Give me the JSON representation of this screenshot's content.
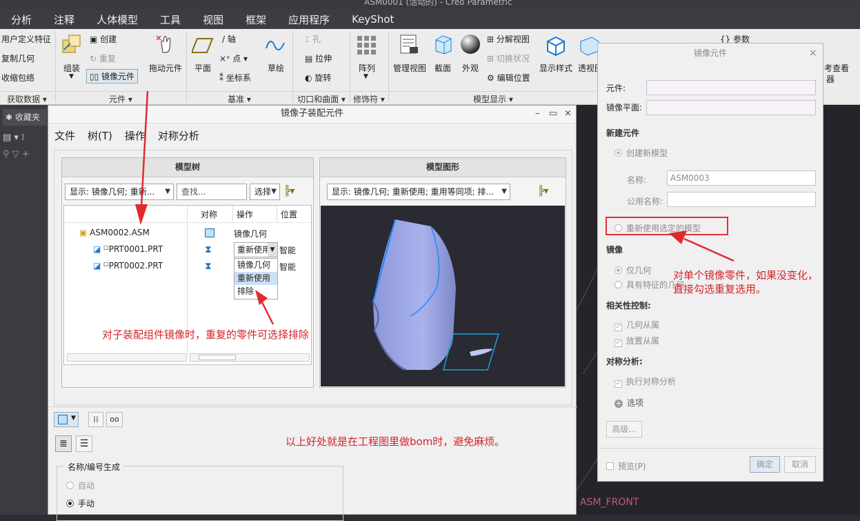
{
  "window_title": "ASM0001 (活动的) - Creo Parametric",
  "menu_tabs": [
    "分析",
    "注释",
    "人体模型",
    "工具",
    "视图",
    "框架",
    "应用程序",
    "KeyShot"
  ],
  "ribbon": {
    "get_data": {
      "items": [
        "用户定义特征",
        "复制几何",
        "收缩包络"
      ],
      "label": "获取数据"
    },
    "component": {
      "assemble": "组装",
      "create": "创建",
      "repeat": "重复",
      "mirror": "镜像元件",
      "drag": "拖动元件",
      "label": "元件"
    },
    "datum": {
      "plane": "平面",
      "axis": "轴",
      "point": "点",
      "csys": "坐标系",
      "sketch": "草绘",
      "label": "基准"
    },
    "cut_surface": {
      "hole": "孔",
      "extrude": "拉伸",
      "revolve": "旋转",
      "label": "切口和曲面"
    },
    "modifiers": {
      "pattern": "阵列",
      "label": "修饰符"
    },
    "model_display": {
      "manage_views": "管理视图",
      "section": "截面",
      "appearance": "外观",
      "explode_view": "分解视图",
      "toggle_status": "切换状况",
      "edit_position": "编辑位置",
      "display_style": "显示样式",
      "perspective": "透视图",
      "label": "模型显示"
    },
    "partial_right": {
      "params": "参数",
      "ref_viewer_1": "考查看",
      "ref_viewer_2": "器"
    }
  },
  "left_strip": {
    "favorites": "收藏夹"
  },
  "mirror_subasm_dialog": {
    "title": "镜像子装配元件",
    "menu": [
      "文件",
      "树(T)",
      "操作",
      "对称分析"
    ],
    "model_tree": {
      "header": "模型树",
      "display_combo": "显示: 镜像几何; 重新...",
      "find_placeholder": "查找...",
      "select_combo": "选择",
      "columns": {
        "symmetry": "对称",
        "operation": "操作",
        "position": "位置"
      },
      "rows": [
        {
          "name": "ASM0002.ASM",
          "operation": "镜像几何",
          "position": ""
        },
        {
          "name": "PRT0001.PRT",
          "operation": "重新使用",
          "position": "智能"
        },
        {
          "name": "PRT0002.PRT",
          "operation": "",
          "position": "智能"
        }
      ],
      "dropdown_options": [
        "镜像几何",
        "重新使用",
        "排除"
      ]
    },
    "model_graphic": {
      "header": "模型图形",
      "display_combo": "显示: 镜像几何; 重新使用; 重用等同项; 排..."
    },
    "name_generation": {
      "label": "名称/编号生成",
      "auto": "自动",
      "manual": "手动"
    }
  },
  "mirror_component_dialog": {
    "title": "镜像元件",
    "component_label": "元件:",
    "mirror_plane_label": "镜像平面:",
    "new_component_heading": "新建元件",
    "create_new_model": "创建新模型",
    "name_label": "名称:",
    "name_value": "ASM0003",
    "common_name_label": "公用名称:",
    "reuse_selected": "重新使用选定的模型",
    "mirror_heading": "镜像",
    "geometry_only": "仅几何",
    "with_features": "具有特征的几何",
    "dependency_heading": "相关性控制:",
    "geometry_dependent": "几何从属",
    "placement_dependent": "放置从属",
    "symmetry_heading": "对称分析:",
    "perform_symmetry": "执行对称分析",
    "options": "选项",
    "advanced": "高级...",
    "preview": "预览(P)",
    "ok": "确定",
    "cancel": "取消"
  },
  "annotations": {
    "a1": "对子装配组件镜像时，重复的零件可选择排除",
    "a2_line1": "对单个镜像零件，如果没变化，",
    "a2_line2": "直接勾选重复选用。",
    "a3": "以上好处就是在工程图里做bom时，避免麻烦。"
  },
  "background_label": "ASM_FRONT",
  "colors": {
    "annotation": "#d2242a",
    "highlight": "#cce0f7",
    "viewport": "#2a2a33",
    "edge": "#1a8cff"
  }
}
